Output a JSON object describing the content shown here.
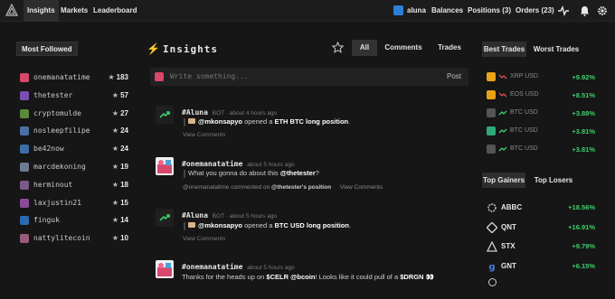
{
  "topbar": {
    "nav": [
      "Insights",
      "Markets",
      "Leaderboard"
    ],
    "user": "aluna",
    "balances": "Balances",
    "positions": "Positions (3)",
    "orders": "Orders (23)"
  },
  "left": {
    "title": "Most Followed",
    "users": [
      {
        "name": "onemanatatime",
        "count": "183",
        "color": "#d9476b"
      },
      {
        "name": "thetester",
        "count": "57",
        "color": "#7a4fb0"
      },
      {
        "name": "cryptomulde",
        "count": "27",
        "color": "#5a8a3a"
      },
      {
        "name": "nosleepfilipe",
        "count": "24",
        "color": "#4a6fa5"
      },
      {
        "name": "be42now",
        "count": "24",
        "color": "#3a6ea8"
      },
      {
        "name": "marcdekoning",
        "count": "19",
        "color": "#6b7d8f"
      },
      {
        "name": "herminout",
        "count": "18",
        "color": "#7a5a8a"
      },
      {
        "name": "laxjustin21",
        "count": "15",
        "color": "#8a4a9a"
      },
      {
        "name": "finguk",
        "count": "14",
        "color": "#2a6ab0"
      },
      {
        "name": "nattylitecoin",
        "count": "10",
        "color": "#9a5a7a"
      }
    ]
  },
  "center": {
    "title": "Insights",
    "tabs": [
      "All",
      "Comments",
      "Trades"
    ],
    "composer_placeholder": "Write something...",
    "post_label": "Post",
    "posts": [
      {
        "author": "#Aluna",
        "meta": "BOT · about 4 hours ago",
        "mention": "@mkonsapyo",
        "text_mid": " opened a ",
        "pair": "ETH BTC long position",
        "link": "View Comments"
      },
      {
        "author": "#onemanatatime",
        "meta": "about 5 hours ago",
        "text": "What you gonna do about this ",
        "mention": "@thetester",
        "text_end": "?",
        "sub_user": "@onemanatatime",
        "sub_mid": " commented on ",
        "sub_target": "@thetester's position",
        "link": "View Comments"
      },
      {
        "author": "#Aluna",
        "meta": "BOT · about 5 hours ago",
        "mention": "@mkonsapyo",
        "text_mid": " opened a ",
        "pair": "BTC USD long position",
        "link": "View Comments"
      },
      {
        "author": "#onemanatatime",
        "meta": "about 5 hours ago",
        "t1": "Thanks for the heads up on ",
        "cash1": "$CELR",
        "t2": " ",
        "mention": "@bcoin",
        "t3": "! Looks like it could pull of a ",
        "cash2": "$DRGN",
        "emoji": " 👀"
      }
    ]
  },
  "right": {
    "trade_tabs": [
      "Best Trades",
      "Worst Trades"
    ],
    "trades": [
      {
        "pair": "XRP USD",
        "value": "+9.92%",
        "icon_color": "#e8a317",
        "arrow_color": "#e05050"
      },
      {
        "pair": "EOS USD",
        "value": "+8.51%",
        "icon_color": "#e8a317",
        "arrow_color": "#e05050"
      },
      {
        "pair": "BTC USD",
        "value": "+3.88%",
        "icon_color": "#555555",
        "arrow_color": "#3ecf6a"
      },
      {
        "pair": "BTC USD",
        "value": "+3.81%",
        "icon_color": "#2fa87a",
        "arrow_color": "#3ecf6a"
      },
      {
        "pair": "BTC USD",
        "value": "+3.81%",
        "icon_color": "#555555",
        "arrow_color": "#3ecf6a"
      }
    ],
    "gain_tabs": [
      "Top Gainers",
      "Top Losers"
    ],
    "gainers": [
      {
        "symbol": "ABBC",
        "value": "+18.56%",
        "icon": "abbc-icon"
      },
      {
        "symbol": "QNT",
        "value": "+16.91%",
        "icon": "qnt-icon"
      },
      {
        "symbol": "STX",
        "value": "+9.79%",
        "icon": "stx-icon"
      },
      {
        "symbol": "GNT",
        "value": "+6.15%",
        "icon": "gnt-icon"
      }
    ]
  }
}
